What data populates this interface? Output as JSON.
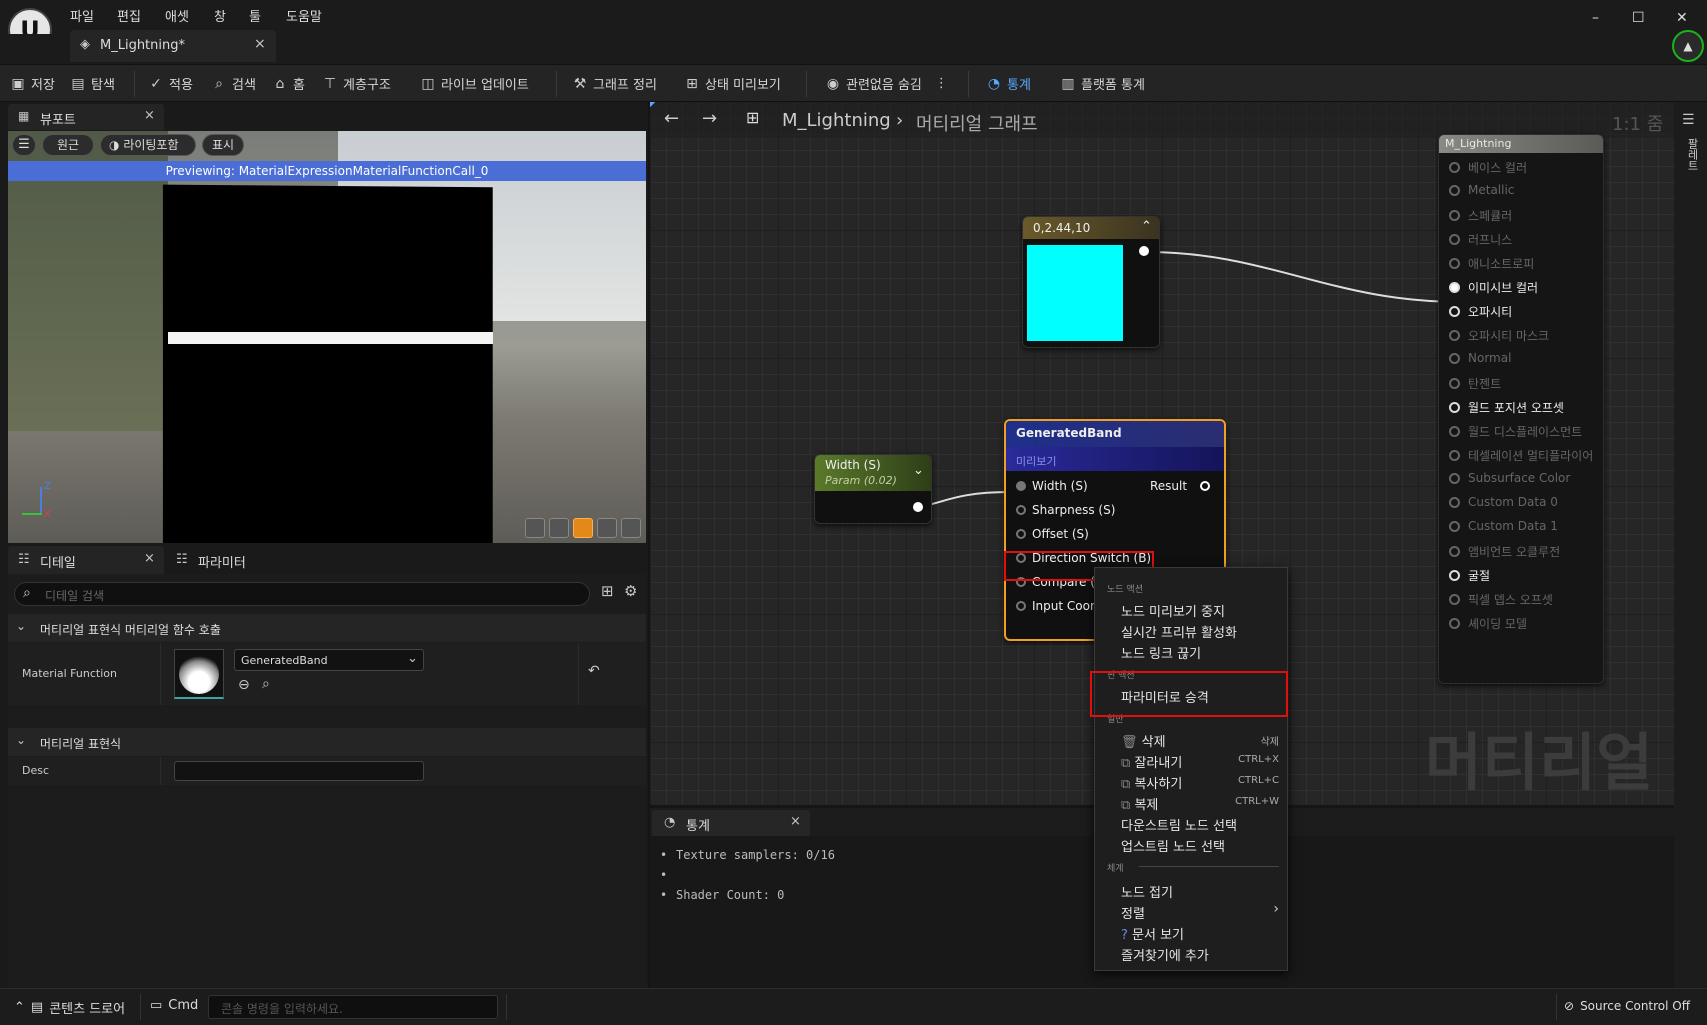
{
  "menu": {
    "file": "파일",
    "edit": "편집",
    "asset": "애셋",
    "window": "창",
    "tools": "툴",
    "help": "도움말"
  },
  "window": {
    "minimize": "–",
    "maximize": "☐",
    "close": "✕"
  },
  "tab": {
    "title": "M_Lightning*",
    "close": "×"
  },
  "toolbar": {
    "save": "저장",
    "browse": "탐색",
    "apply": "적용",
    "search": "검색",
    "home": "홈",
    "hierarchy": "계층구조",
    "live_update": "라이브 업데이트",
    "clean_graph": "그래프 정리",
    "preview_state": "상태 미리보기",
    "hide_unrelated": "관련없음 숨김",
    "stats": "통계",
    "platform_stats": "플랫폼 통계"
  },
  "viewport": {
    "tab": "뷰포트",
    "perspective": "원근",
    "lighting": "라이팅포함",
    "show": "표시",
    "preview_text": "Previewing: MaterialExpressionMaterialFunctionCall_0",
    "axis_z": "Z",
    "axis_x": "X"
  },
  "details": {
    "tab": "디테일",
    "params_tab": "파라미터",
    "search_placeholder": "디테일 검색",
    "section1": "머티리얼 표현식 머티리얼 함수 호출",
    "material_function_label": "Material Function",
    "material_function_value": "GeneratedBand",
    "section2": "머티리얼 표현식",
    "desc_label": "Desc"
  },
  "graph": {
    "title": "M_Lightning",
    "breadcrumb": "머티리얼 그래프",
    "zoom": "1:1 줌",
    "watermark": "머티리얼",
    "side_tab": "팔레트"
  },
  "const_node": {
    "title": "0,2.44,10",
    "color": "#00ffff"
  },
  "width_node": {
    "title": "Width (S)",
    "subtitle": "Param (0.02)"
  },
  "band_node": {
    "title": "GeneratedBand",
    "preview": "미리보기",
    "result": "Result",
    "inputs": [
      "Width (S)",
      "Sharpness (S)",
      "Offset (S)",
      "Direction Switch (B)",
      "Compare (S)",
      "Input Coord"
    ]
  },
  "material_node": {
    "title": "M_Lightning",
    "outputs": [
      {
        "label": "베이스 컬러",
        "active": false
      },
      {
        "label": "Metallic",
        "active": false
      },
      {
        "label": "스페큘러",
        "active": false
      },
      {
        "label": "러프니스",
        "active": false
      },
      {
        "label": "애니소트로피",
        "active": false
      },
      {
        "label": "이미시브 컬러",
        "active": true
      },
      {
        "label": "오파시티",
        "active": true
      },
      {
        "label": "오파시티 마스크",
        "active": false
      },
      {
        "label": "Normal",
        "active": false
      },
      {
        "label": "탄젠트",
        "active": false
      },
      {
        "label": "월드 포지션 오프셋",
        "active": true
      },
      {
        "label": "월드 디스플레이스먼트",
        "active": false
      },
      {
        "label": "테셀레이션 멀티플라이어",
        "active": false
      },
      {
        "label": "Subsurface Color",
        "active": false
      },
      {
        "label": "Custom Data 0",
        "active": false
      },
      {
        "label": "Custom Data 1",
        "active": false
      },
      {
        "label": "앰비언트 오클루전",
        "active": false
      },
      {
        "label": "굴절",
        "active": true
      },
      {
        "label": "픽셀 뎁스 오프셋",
        "active": false
      },
      {
        "label": "셰이딩 모델",
        "active": false
      }
    ]
  },
  "context_menu": {
    "section_node": "노드 액션",
    "stop_preview": "노드 미리보기 중지",
    "enable_realtime": "실시간 프리뷰 활성화",
    "break_links": "노드 링크 끊기",
    "section_param": "핀 액션",
    "promote": "파라미터로 승격",
    "section_general": "일반",
    "delete": "삭제",
    "delete_key": "삭제",
    "cut": "잘라내기",
    "cut_key": "CTRL+X",
    "copy": "복사하기",
    "copy_key": "CTRL+C",
    "duplicate": "복제",
    "duplicate_key": "CTRL+W",
    "select_downstream": "다운스트림 노드 선택",
    "select_upstream": "업스트림 노드 선택",
    "section_org": "체계",
    "collapse": "노드 접기",
    "align": "정렬",
    "docs": "문서 보기",
    "add_favorite": "즐겨찾기에 추가"
  },
  "stats": {
    "tab": "통계",
    "line1": "Texture samplers: 0/16",
    "line2": "",
    "line3": "Shader Count: 0"
  },
  "status": {
    "content_drawer": "콘텐츠 드로어",
    "cmd": "Cmd",
    "console_placeholder": "콘솔 명령을 입력하세요.",
    "source_control": "Source Control Off"
  }
}
